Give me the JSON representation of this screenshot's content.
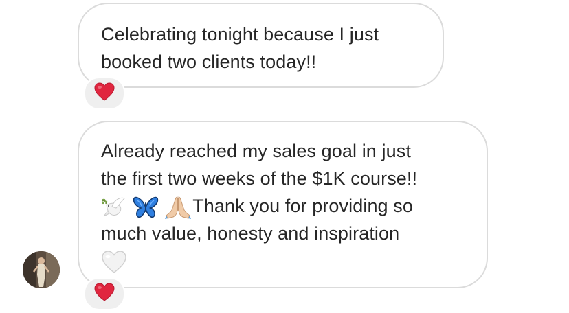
{
  "messages": [
    {
      "lines": [
        "Celebrating tonight because I just",
        "booked two clients today!!"
      ],
      "reaction": "red-heart"
    },
    {
      "lines": [
        "Already reached my sales goal in just",
        "the first two weeks of the $1K course!!"
      ],
      "emoji_line_text": "Thank you for providing so",
      "emojis": [
        "dove-icon",
        "butterfly-icon",
        "folded-hands-icon"
      ],
      "last_line": "much value, honesty and inspiration",
      "trailing_emoji": "white-heart-icon",
      "reaction": "red-heart"
    }
  ],
  "colors": {
    "bubble_border": "#dbdbdb",
    "text": "#262626",
    "reaction_bg": "#efefef",
    "heart_red": "#e0263f",
    "butterfly_blue": "#2f7fe0",
    "white_heart": "#f2f2f2"
  }
}
